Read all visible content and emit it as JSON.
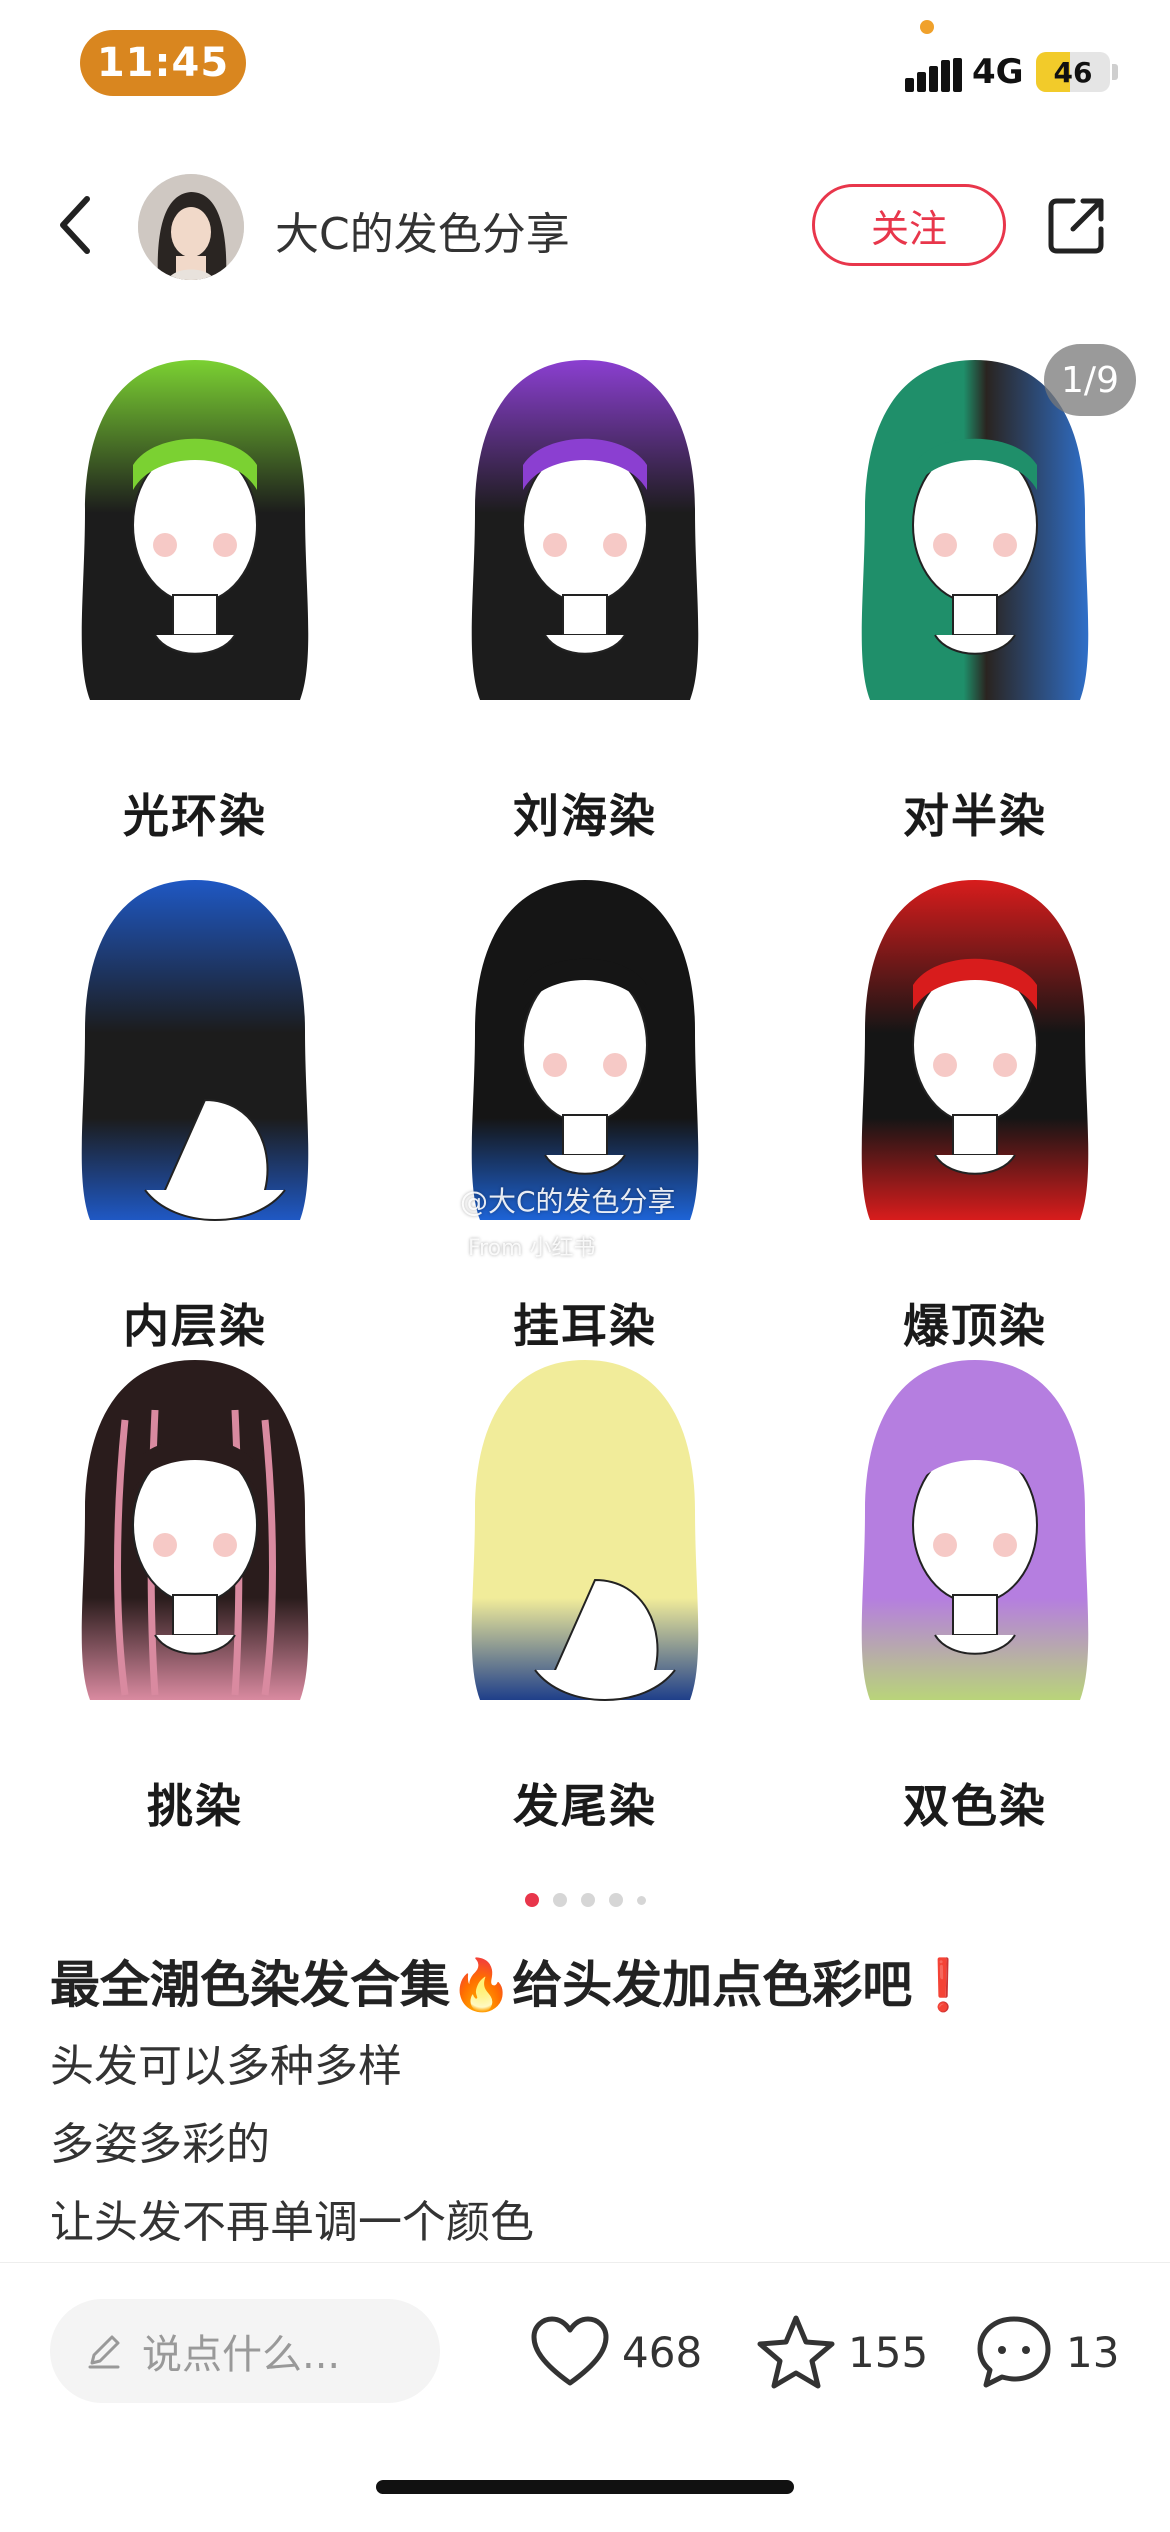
{
  "status_bar": {
    "time": "11:45",
    "network": "4G",
    "battery": "46",
    "battery_level": 0.46,
    "accent_color": "#d9861f"
  },
  "header": {
    "back_icon": "chevron-left-icon",
    "author_name": "大C的发色分享",
    "follow_label": "关注",
    "share_icon": "share-icon",
    "follow_color": "#e8364b"
  },
  "gallery": {
    "page_indicator": "1/9",
    "watermark": "@大C的发色分享",
    "watermark_sub": "From 小红书",
    "cells": [
      {
        "label": "光环染"
      },
      {
        "label": "刘海染"
      },
      {
        "label": "对半染"
      },
      {
        "label": "内层染"
      },
      {
        "label": "挂耳染"
      },
      {
        "label": "爆顶染"
      },
      {
        "label": "挑染"
      },
      {
        "label": "发尾染"
      },
      {
        "label": "双色染"
      }
    ],
    "dots_total": 5,
    "dots_active": 1
  },
  "post": {
    "title": "最全潮色染发合集🔥给头发加点色彩吧❗",
    "lines": [
      "头发可以多种多样",
      "多姿多彩的",
      "让头发不再单调一个颜色"
    ]
  },
  "bottom_bar": {
    "comment_placeholder": "说点什么...",
    "likes": "468",
    "stars": "155",
    "comments": "13"
  }
}
